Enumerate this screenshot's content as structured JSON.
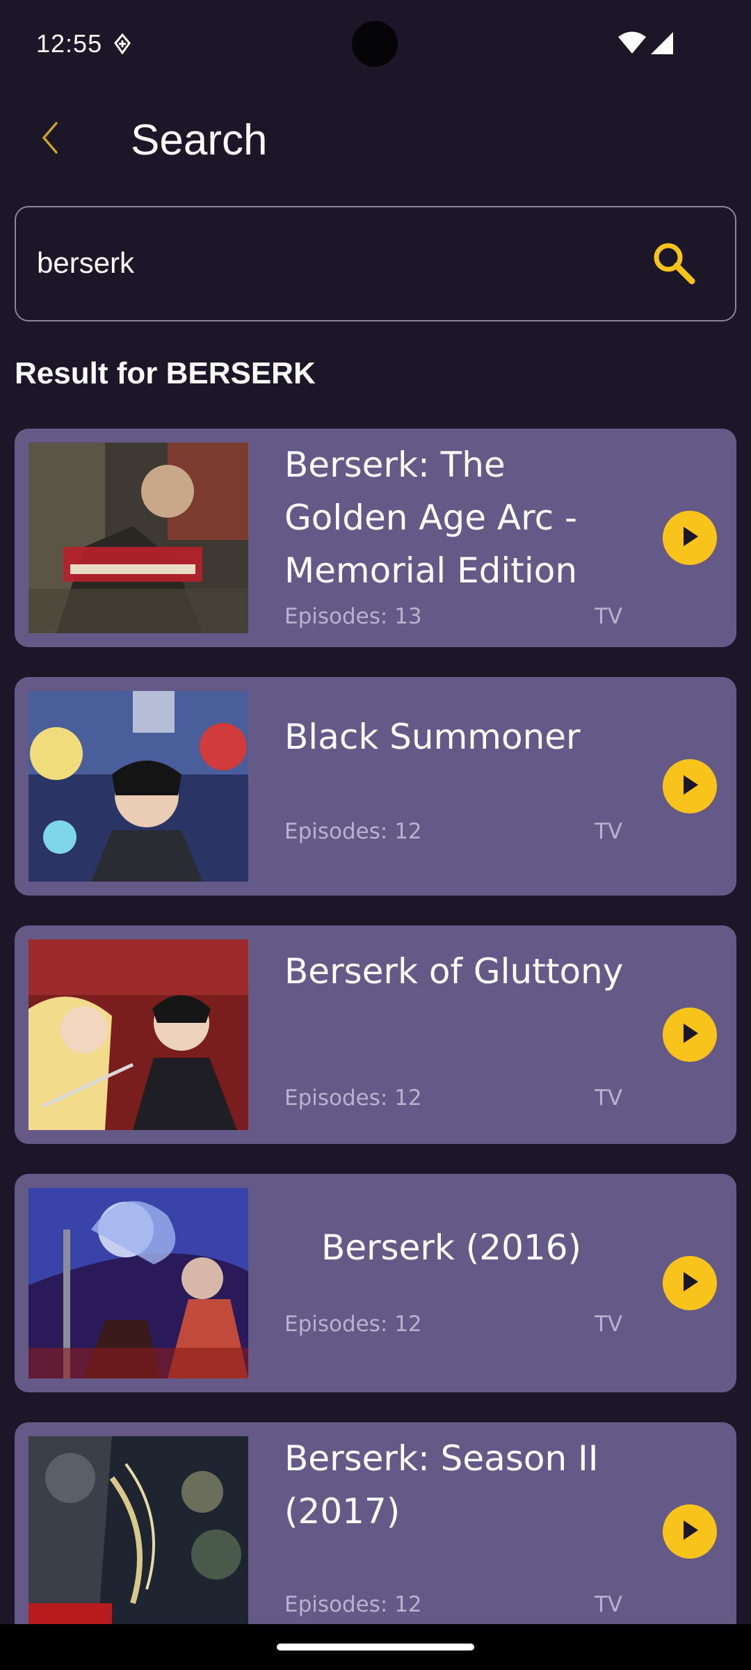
{
  "status_bar": {
    "time": "12:55",
    "icons": [
      "data-saver-icon",
      "wifi-icon",
      "cellular-signal-icon"
    ]
  },
  "header": {
    "title": "Search",
    "back_icon": "chevron-left-icon"
  },
  "search": {
    "value": "berserk",
    "icon": "search-icon"
  },
  "results": {
    "heading": "Result for BERSERK",
    "items": [
      {
        "title": "Berserk: The Golden Age Arc - Memorial Edition",
        "episodes": "Episodes: 13",
        "type": "TV"
      },
      {
        "title": "Black Summoner",
        "episodes": "Episodes: 12",
        "type": "TV"
      },
      {
        "title": "Berserk of Gluttony",
        "episodes": "Episodes: 12",
        "type": "TV"
      },
      {
        "title": "Berserk (2016)",
        "episodes": "Episodes: 12",
        "type": "TV"
      },
      {
        "title": "Berserk: Season II (2017)",
        "episodes": "Episodes: 12",
        "type": "TV"
      }
    ]
  },
  "colors": {
    "background": "#1b1728",
    "card": "#645987",
    "accent": "#f8c31a",
    "text": "#ffffff",
    "muted_text": "#b9b2cf"
  }
}
